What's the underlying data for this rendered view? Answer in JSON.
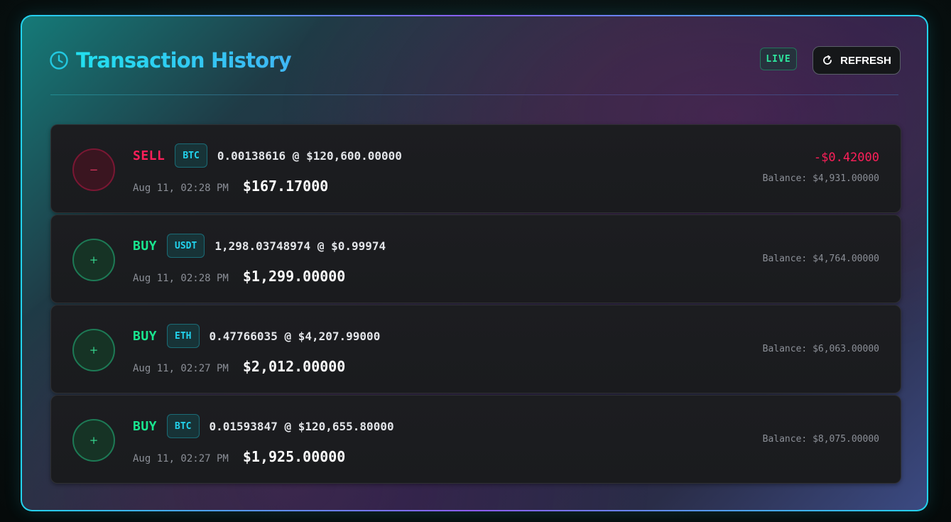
{
  "header": {
    "title": "Transaction History",
    "live_label": "LIVE",
    "refresh_label": "REFRESH"
  },
  "icons": {
    "title": "clock-icon",
    "refresh": "refresh-icon",
    "sell": "minus-icon",
    "buy": "plus-icon"
  },
  "colors": {
    "accent": "#22d3ee",
    "sell": "#ff1f5a",
    "buy": "#19e58f",
    "live": "#2ee59d"
  },
  "transactions": [
    {
      "type": "sell",
      "side_label": "SELL",
      "icon_glyph": "−",
      "asset": "BTC",
      "quantity_price": "0.00138616 @ $120,600.00000",
      "time": "Aug 11, 02:28 PM",
      "total": "$167.17000",
      "change": "-$0.42000",
      "balance": "Balance: $4,931.00000"
    },
    {
      "type": "buy",
      "side_label": "BUY",
      "icon_glyph": "+",
      "asset": "USDT",
      "quantity_price": "1,298.03748974 @ $0.99974",
      "time": "Aug 11, 02:28 PM",
      "total": "$1,299.00000",
      "change": "",
      "balance": "Balance: $4,764.00000"
    },
    {
      "type": "buy",
      "side_label": "BUY",
      "icon_glyph": "+",
      "asset": "ETH",
      "quantity_price": "0.47766035 @ $4,207.99000",
      "time": "Aug 11, 02:27 PM",
      "total": "$2,012.00000",
      "change": "",
      "balance": "Balance: $6,063.00000"
    },
    {
      "type": "buy",
      "side_label": "BUY",
      "icon_glyph": "+",
      "asset": "BTC",
      "quantity_price": "0.01593847 @ $120,655.80000",
      "time": "Aug 11, 02:27 PM",
      "total": "$1,925.00000",
      "change": "",
      "balance": "Balance: $8,075.00000"
    }
  ]
}
